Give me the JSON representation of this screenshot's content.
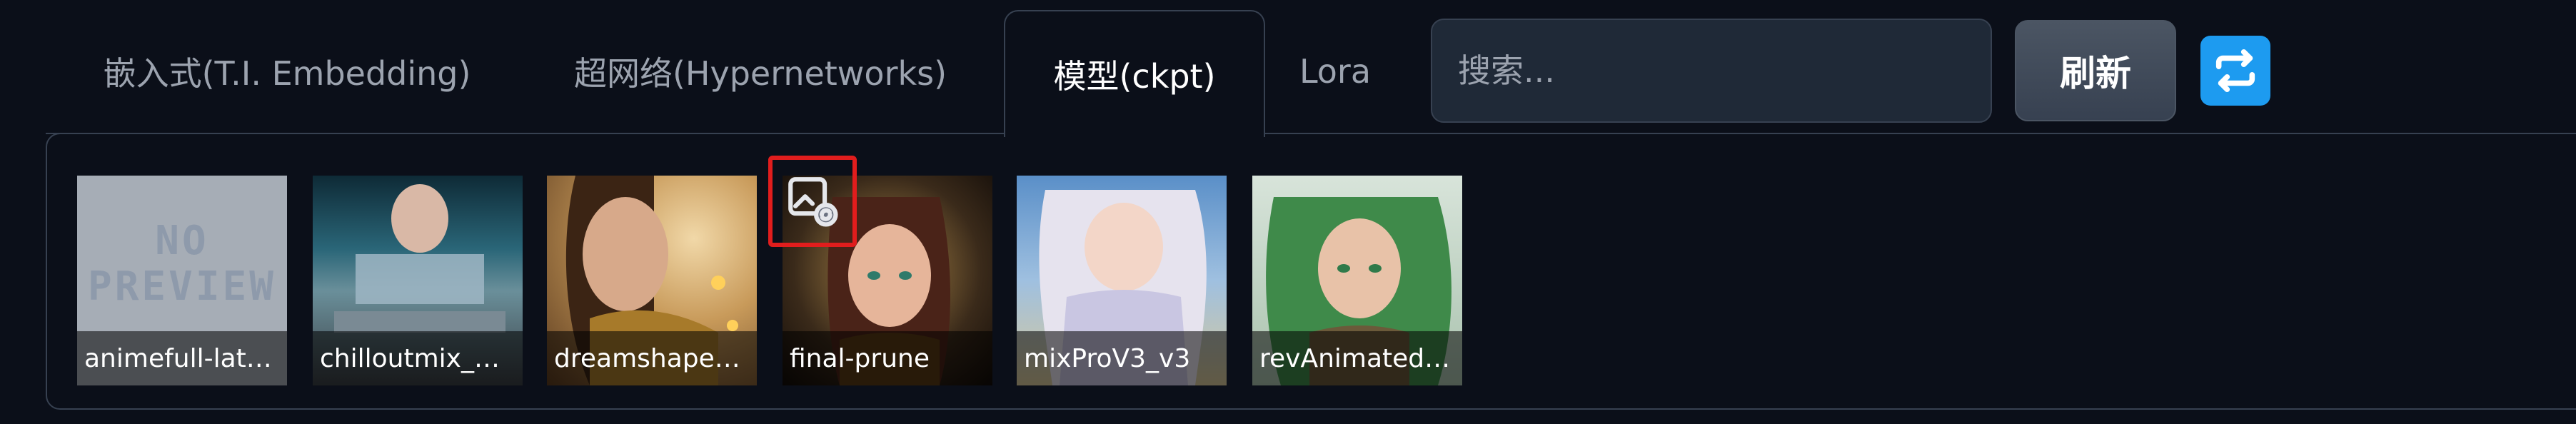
{
  "tabs": [
    {
      "label": "嵌入式(T.I. Embedding)",
      "active": false
    },
    {
      "label": "超网络(Hypernetworks)",
      "active": false
    },
    {
      "label": "模型(ckpt)",
      "active": true
    },
    {
      "label": "Lora",
      "active": false
    }
  ],
  "search": {
    "placeholder": "搜索...",
    "value": ""
  },
  "refresh_label": "刷新",
  "cycle_icon": "swap-arrows-icon",
  "no_preview_text": "NO PREVIEW",
  "cards": [
    {
      "label": "animefull-lat…",
      "full_name": "animefull-latest",
      "preview": "no-preview"
    },
    {
      "label": "chilloutmix_…",
      "full_name": "chilloutmix",
      "preview": "image"
    },
    {
      "label": "dreamshape…",
      "full_name": "dreamshaper",
      "preview": "image"
    },
    {
      "label": "final-prune",
      "full_name": "final-prune",
      "preview": "image"
    },
    {
      "label": "mixProV3_v3",
      "full_name": "mixProV3_v3",
      "preview": "image"
    },
    {
      "label": "revAnimated…",
      "full_name": "revAnimated",
      "preview": "image"
    }
  ],
  "colors": {
    "background": "#0b0f19",
    "border": "#374151",
    "accent_blue": "#1d9bf0",
    "highlight_red": "#e11d1d"
  }
}
